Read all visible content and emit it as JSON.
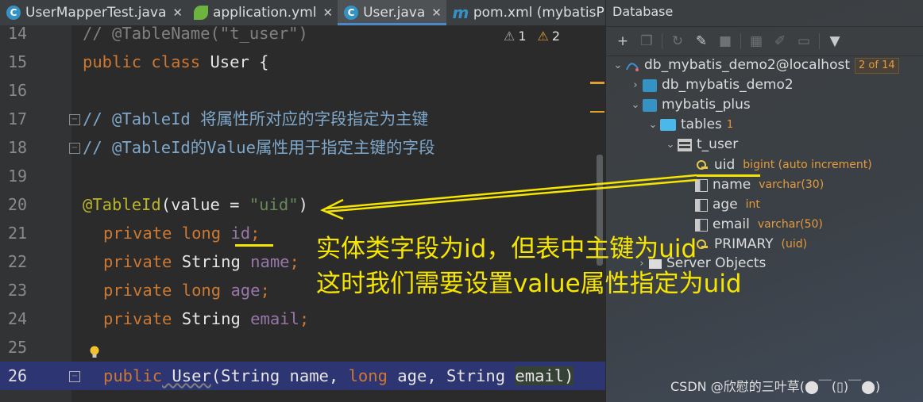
{
  "tabs": [
    {
      "label": "UserMapperTest.java",
      "icon": "java-class-icon"
    },
    {
      "label": "application.yml",
      "icon": "spring-config-icon"
    },
    {
      "label": "User.java",
      "icon": "java-class-icon",
      "active": true
    },
    {
      "label": "pom.xml (mybatisPlus_",
      "icon": "maven-icon"
    }
  ],
  "editor": {
    "warnings": {
      "weak": "1",
      "strong": "2"
    },
    "lines": [
      {
        "num": "14"
      },
      {
        "num": "15"
      },
      {
        "num": "16"
      },
      {
        "num": "17"
      },
      {
        "num": "18"
      },
      {
        "num": "19"
      },
      {
        "num": "20"
      },
      {
        "num": "21"
      },
      {
        "num": "22"
      },
      {
        "num": "23"
      },
      {
        "num": "24"
      },
      {
        "num": "25"
      },
      {
        "num": "26"
      }
    ],
    "code": {
      "l14": "// @TableName(\"t_user\")",
      "l15_kw": "public class",
      "l15_name": " User {",
      "l17_a": "// @TableId",
      "l17_b": " 将属性所对应的字段指定为主键",
      "l18_a": "// @TableId",
      "l18_b": "的Value属性用于指定主键的字段",
      "l20_ann": "@TableId",
      "l20_a": "(value = ",
      "l20_str": "\"uid\"",
      "l20_b": ")",
      "l21_kw": "private long",
      "l21_f": " id",
      "l21_e": ";",
      "l22_kw": "private",
      "l22_t": " String",
      "l22_f": " name",
      "l22_e": ";",
      "l23_kw": "private long",
      "l23_f": " age",
      "l23_e": ";",
      "l24_kw": "private",
      "l24_t": " String",
      "l24_f": " email",
      "l24_e": ";",
      "l26_kw": "public",
      "l26_n": " User",
      "l26_a": "(String name, ",
      "l26_k2": "long",
      "l26_b": " age, String ",
      "l26_c": "email)"
    }
  },
  "database": {
    "title": "Database",
    "toolbar": [
      "add-icon",
      "copy-icon",
      "refresh-icon",
      "properties-icon",
      "stop-icon",
      "table-icon",
      "edit-icon",
      "console-icon",
      "filter-icon"
    ],
    "tree": {
      "connection": {
        "label": "db_mybatis_demo2@localhost",
        "badge": "2 of 14"
      },
      "schema1": {
        "label": "db_mybatis_demo2"
      },
      "schema2": {
        "label": "mybatis_plus"
      },
      "tables": {
        "label": "tables",
        "count": "1"
      },
      "table": {
        "label": "t_user"
      },
      "columns": [
        {
          "name": "uid",
          "type": "bigint (auto increment)",
          "icon": "primary-key-icon"
        },
        {
          "name": "name",
          "type": "varchar(30)",
          "icon": "column-icon"
        },
        {
          "name": "age",
          "type": "int",
          "icon": "column-icon"
        },
        {
          "name": "email",
          "type": "varchar(50)",
          "icon": "column-icon"
        }
      ],
      "primary": {
        "label": "PRIMARY",
        "meta": "(uid)"
      },
      "server_objects": {
        "label": "Server Objects"
      }
    }
  },
  "annotation": {
    "line1": "实体类字段为id，但表中主键为uid",
    "line2": "这时我们需要设置value属性指定为uid",
    "color": "#f5e500"
  },
  "watermark": "CSDN @欣慰的三叶草(⬤￣(▯)￣⬤)"
}
